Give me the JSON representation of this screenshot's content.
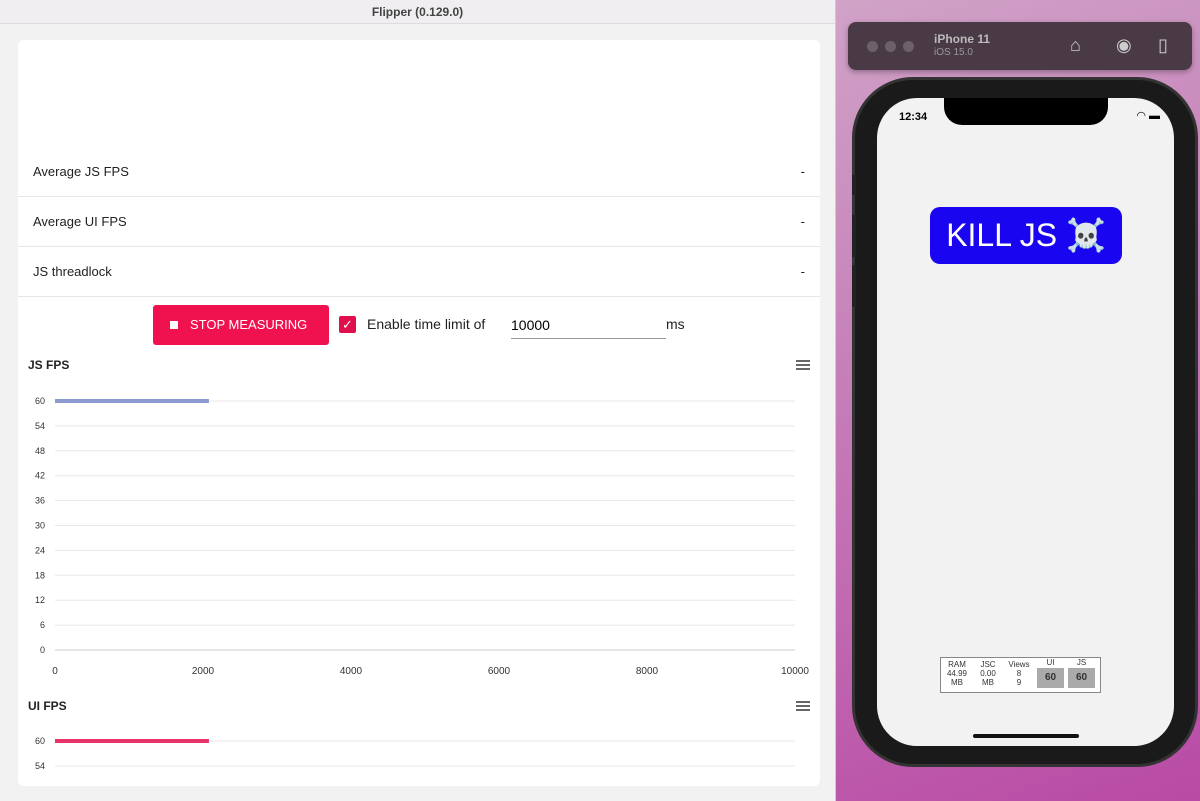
{
  "window": {
    "title": "Flipper (0.129.0)"
  },
  "stats": [
    {
      "label": "Average JS FPS",
      "value": "-"
    },
    {
      "label": "Average UI FPS",
      "value": "-"
    },
    {
      "label": "JS threadlock",
      "value": "-"
    }
  ],
  "controls": {
    "stop_label": "STOP MEASURING",
    "time_limit_checked": true,
    "time_limit_label": "Enable time limit of",
    "time_limit_value": "10000",
    "unit": "ms",
    "accent": "#f0114f"
  },
  "chart_data": [
    {
      "type": "line",
      "title": "JS FPS",
      "xlim": [
        0,
        10000
      ],
      "ylim": [
        0,
        60
      ],
      "x_ticks": [
        "0",
        "2000",
        "4000",
        "6000",
        "8000",
        "10000"
      ],
      "y_ticks": [
        "0",
        "6",
        "12",
        "18",
        "24",
        "30",
        "36",
        "42",
        "48",
        "54",
        "60"
      ],
      "grid": true,
      "color": "#8c9ad0",
      "series": [
        {
          "x": [
            0,
            2080
          ],
          "y": [
            60,
            60
          ]
        }
      ]
    },
    {
      "type": "line",
      "title": "UI FPS",
      "xlim": [
        0,
        10000
      ],
      "ylim": [
        0,
        60
      ],
      "y_ticks": [
        "54",
        "60"
      ],
      "grid": true,
      "color": "#e8336b",
      "series": [
        {
          "x": [
            0,
            2080
          ],
          "y": [
            60,
            60
          ]
        }
      ]
    }
  ],
  "simulator": {
    "device": "iPhone 11",
    "os": "iOS 15.0",
    "time": "12:34",
    "button_label": "KILL JS ☠️",
    "button_color": "#1a05f0",
    "perf": {
      "ram_label": "RAM",
      "ram_value": "44.99",
      "ram_unit": "MB",
      "jsc_label": "JSC",
      "jsc_value": "0.00",
      "jsc_unit": "MB",
      "views_label": "Views",
      "views_a": "8",
      "views_b": "9",
      "ui_label": "UI",
      "ui_value": "60",
      "js_label": "JS",
      "js_value": "60"
    }
  }
}
